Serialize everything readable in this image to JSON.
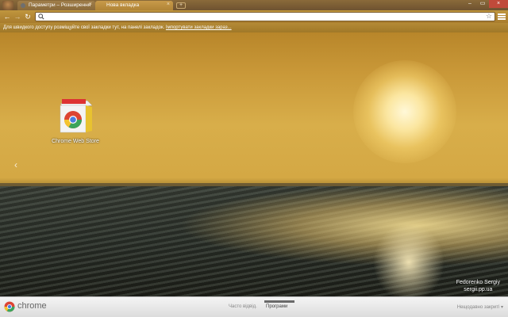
{
  "tabs": [
    {
      "label": "Параметри – Розширення"
    },
    {
      "label": "Нова вкладка"
    }
  ],
  "toolbar": {
    "address_value": ""
  },
  "bookmarks_bar": {
    "message": "Для швидкого доступу розміщуйте свої закладки тут, на панелі закладок.",
    "import_link": "Імпортувати закладки зараз..."
  },
  "apps": [
    {
      "label": "Chrome Web Store",
      "icon": "chrome-web-store-icon"
    }
  ],
  "credit": {
    "line1": "Fedorenko Sergiy",
    "line2": "sergii.pp.ua"
  },
  "footer": {
    "brand": "chrome",
    "tab_most_visited": "Часто відвід.",
    "tab_apps": "Програми",
    "recently_closed": "Нещодавно закриті"
  },
  "colors": {
    "accent": "#b08436",
    "footer_bg": "#e8e8e8"
  }
}
